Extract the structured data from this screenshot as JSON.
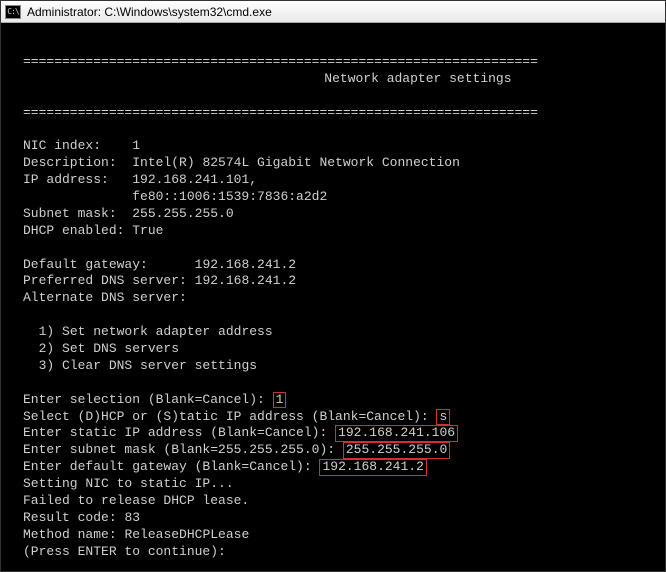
{
  "window": {
    "title": "Administrator: C:\\Windows\\system32\\cmd.exe"
  },
  "section_title": "Network adapter settings",
  "divider": "==================================================================",
  "nic": {
    "index_label": "NIC index:",
    "index_value": "1",
    "description_label": "Description:",
    "description_value": "Intel(R) 82574L Gigabit Network Connection",
    "ip_label": "IP address:",
    "ip_primary": "192.168.241.101,",
    "ip_secondary": "fe80::1006:1539:7836:a2d2",
    "subnet_label": "Subnet mask:",
    "subnet_value": "255.255.255.0",
    "dhcp_label": "DHCP enabled:",
    "dhcp_value": "True",
    "gateway_label": "Default gateway:",
    "gateway_value": "192.168.241.2",
    "pref_dns_label": "Preferred DNS server:",
    "pref_dns_value": "192.168.241.2",
    "alt_dns_label": "Alternate DNS server:",
    "alt_dns_value": ""
  },
  "menu": {
    "item1": "1) Set network adapter address",
    "item2": "2) Set DNS servers",
    "item3": "3) Clear DNS server settings"
  },
  "prompts": {
    "enter_selection_label": "Enter selection (Blank=Cancel):",
    "enter_selection_value": "1",
    "dhcp_or_static_label": "Select (D)HCP or (S)tatic IP address (Blank=Cancel):",
    "dhcp_or_static_value": "s",
    "static_ip_label": "Enter static IP address (Blank=Cancel):",
    "static_ip_value": "192.168.241.106",
    "subnet_mask_label": "Enter subnet mask (Blank=255.255.255.0):",
    "subnet_mask_value": "255.255.255.0",
    "default_gateway_label": "Enter default gateway (Blank=Cancel):",
    "default_gateway_value": "192.168.241.2"
  },
  "result": {
    "setting_msg": "Setting NIC to static IP...",
    "failed_msg": "Failed to release DHCP lease.",
    "code_label": "Result code:",
    "code_value": "83",
    "method_label": "Method name:",
    "method_value": "ReleaseDHCPLease",
    "continue_msg": "(Press ENTER to continue):"
  }
}
